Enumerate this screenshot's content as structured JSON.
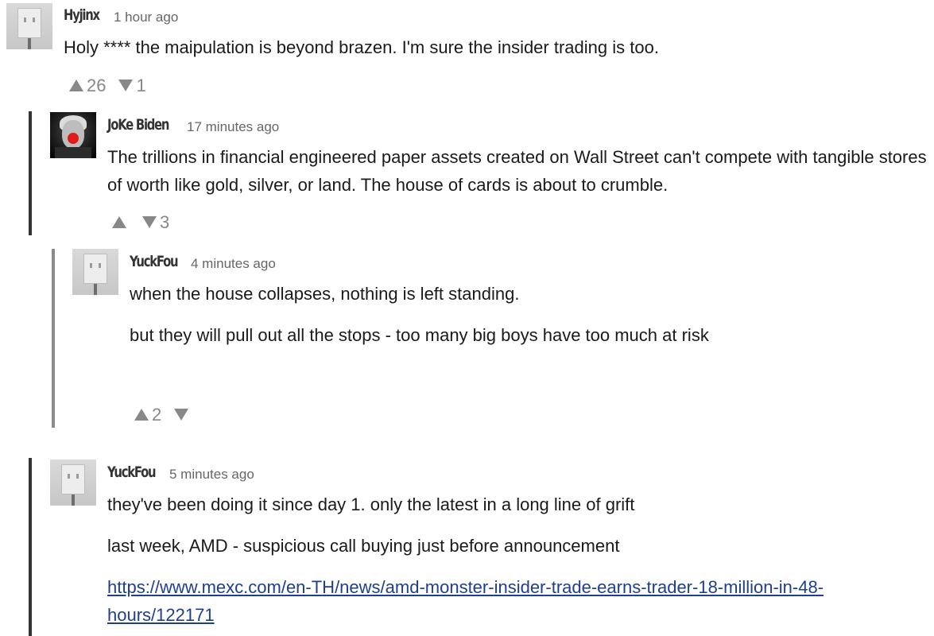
{
  "comments": [
    {
      "username": "Hyjinx",
      "timestamp": "1 hour ago",
      "body": [
        "Holy **** the maipulation is beyond brazen. I'm sure the insider trading is too."
      ],
      "upvotes": "26",
      "downvotes": "1",
      "avatar": "box-head-avatar"
    },
    {
      "username": "JoKe Biden",
      "timestamp": "17 minutes ago",
      "body": [
        "The trillions in financial engineered paper assets created on Wall Street can't compete with tangible stores of worth like gold, silver, or land.  The house of cards is about to crumble."
      ],
      "upvotes": "",
      "downvotes": "3",
      "avatar": "clown-nose-avatar"
    },
    {
      "username": "YuckFou",
      "timestamp": "4 minutes ago",
      "body": [
        "when the house collapses, nothing is left standing.",
        "but they will pull out all the stops - too many big boys have too much at risk"
      ],
      "upvotes": "2",
      "downvotes": "",
      "avatar": "box-head-avatar"
    },
    {
      "username": "YuckFou",
      "timestamp": "5 minutes ago",
      "body": [
        "they've been doing it since day 1.   only the latest in a long line of grift",
        "last week, AMD - suspicious call buying just before announcement"
      ],
      "link": "https://www.mexc.com/en-TH/news/amd-monster-insider-trade-earns-trader-18-million-in-48-hours/122171",
      "upvotes": "",
      "downvotes": "",
      "avatar": "box-head-avatar"
    }
  ],
  "colors": {
    "thread_bar": "#333333",
    "thread_bar_light": "#8a8a8a",
    "link": "#1e3f8f",
    "vote_arrow": "#888888"
  }
}
